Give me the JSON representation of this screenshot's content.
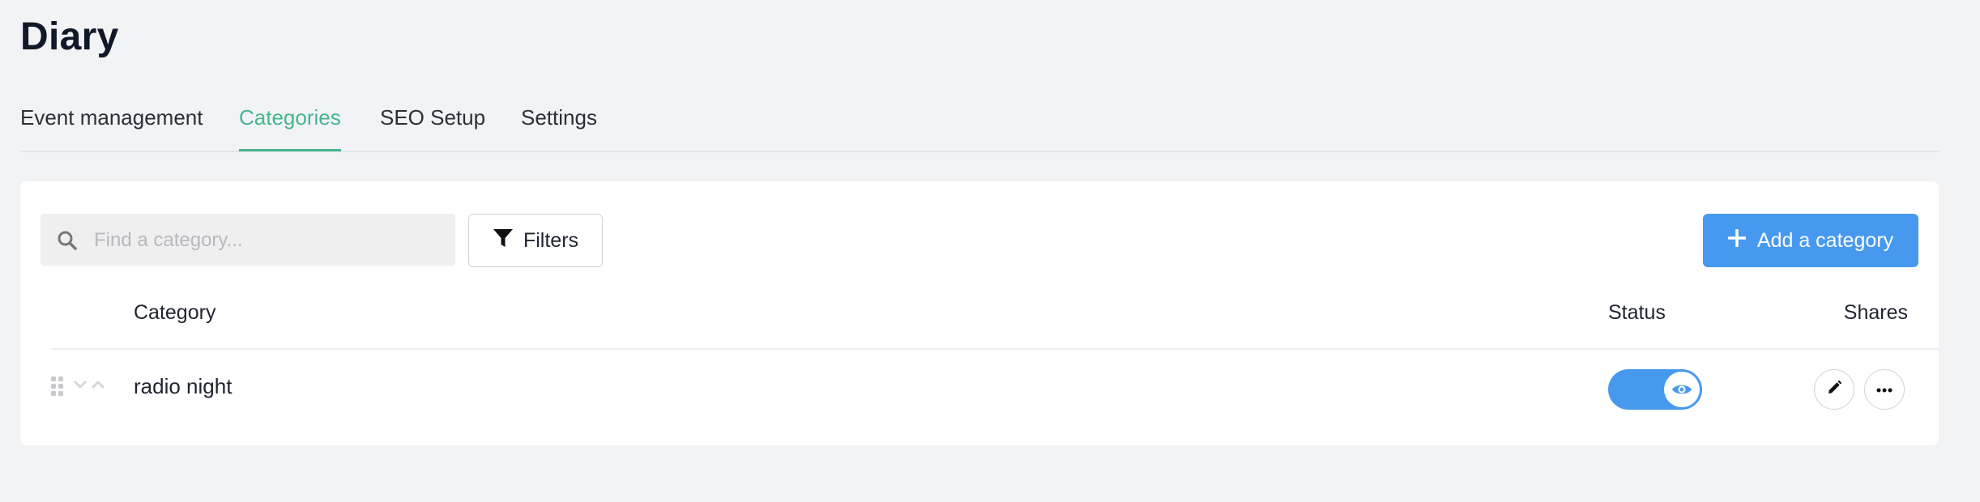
{
  "page": {
    "title": "Diary"
  },
  "tabs": [
    {
      "label": "Event management",
      "active": false
    },
    {
      "label": "Categories",
      "active": true
    },
    {
      "label": "SEO Setup",
      "active": false
    },
    {
      "label": "Settings",
      "active": false
    }
  ],
  "toolbar": {
    "search_placeholder": "Find a category...",
    "search_value": "",
    "filters_label": "Filters",
    "add_label": "Add a category"
  },
  "table": {
    "columns": {
      "category": "Category",
      "status": "Status",
      "shares": "Shares"
    },
    "rows": [
      {
        "name": "radio night",
        "status_visible": true
      }
    ]
  },
  "icons": {
    "search": "search-icon",
    "filters": "funnel-icon",
    "add": "plus-icon",
    "drag": "drag-handle-icon",
    "move_down": "chevron-down-icon",
    "move_up": "chevron-up-icon",
    "visibility": "eye-icon",
    "edit": "pencil-icon",
    "more": "more-horizontal-icon"
  },
  "colors": {
    "accent_tab": "#46b590",
    "primary_button": "#4799f0",
    "page_background": "#f2f3f5"
  }
}
